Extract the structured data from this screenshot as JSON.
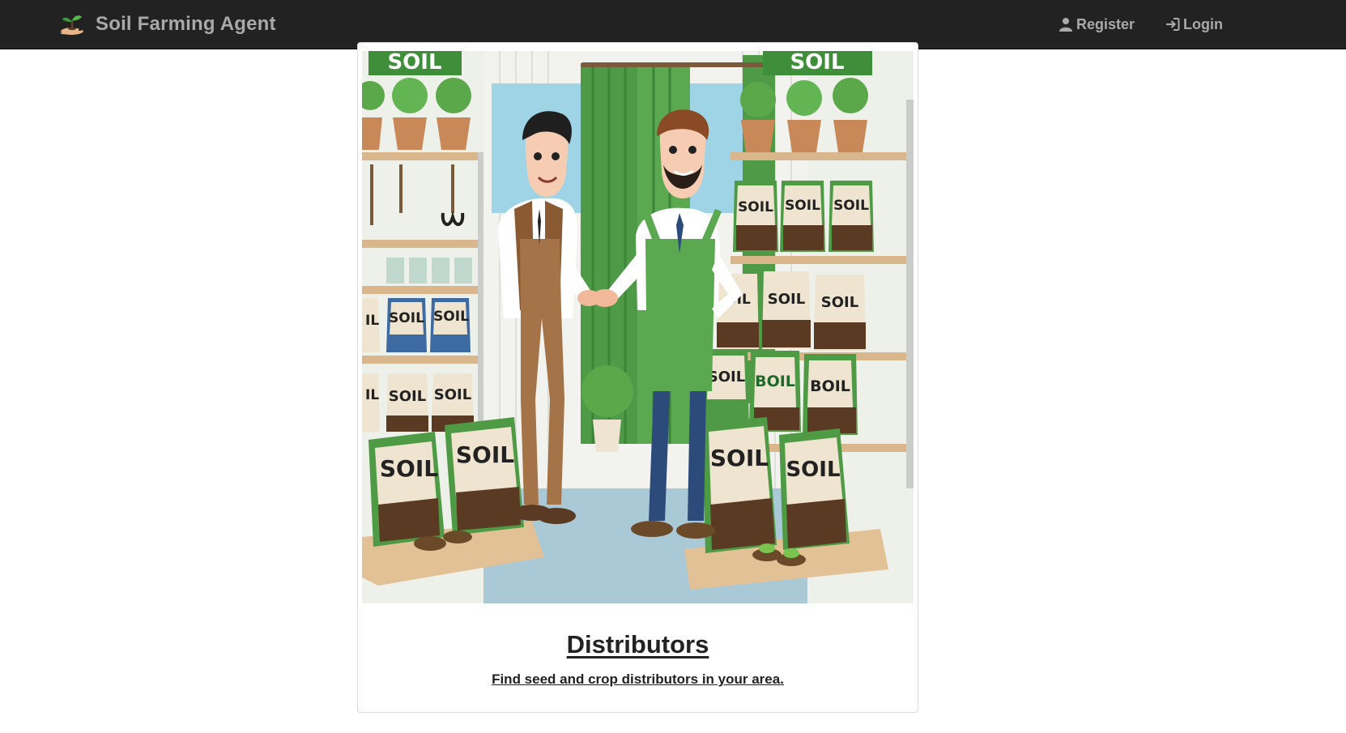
{
  "header": {
    "brand_name": "Soil Farming Agent",
    "brand_icon": "seedling-hand-icon",
    "nav": [
      {
        "label": "Register",
        "icon": "user-icon"
      },
      {
        "label": "Login",
        "icon": "login-icon"
      }
    ]
  },
  "card": {
    "image": {
      "sign_labels": [
        "SOIL",
        "SOIL"
      ],
      "bag_labels": [
        "SOIL",
        "SOIL",
        "SOIL",
        "SOIL",
        "SOIL",
        "SOIL",
        "BOIL",
        "BOIL",
        "SOIL",
        "SOIL",
        "SOIL",
        "SOIL",
        "SOIL",
        "SOIL",
        "SOIL",
        "SOIL",
        "SOIL",
        "SOIL",
        "IL",
        "IL",
        "OIL"
      ]
    },
    "title": "Distributors",
    "description": "Find seed and crop distributors in your area."
  },
  "colors": {
    "navbar_bg": "#222222",
    "nav_text": "#a9a9a9",
    "text_dark": "#222222",
    "brand_green": "#4e9a45"
  }
}
